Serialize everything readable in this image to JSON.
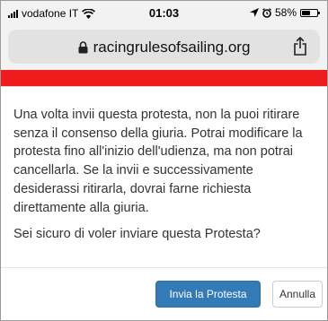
{
  "status_bar": {
    "carrier": "vodafone IT",
    "time": "01:03",
    "battery": "58%",
    "battery_level": 0.58,
    "icons": [
      "signal-icon",
      "wifi-icon",
      "location-icon",
      "alarm-icon",
      "battery-icon"
    ]
  },
  "browser": {
    "url": "racingrulesofsailing.org",
    "icons": [
      "lock-icon",
      "share-icon"
    ]
  },
  "colors": {
    "banner_red": "#ee1c1c",
    "primary_button": "#337ab7",
    "chrome_bg": "#f2f2f2",
    "url_bar_bg": "#e2e2e2"
  },
  "dialog": {
    "message": "Una volta invii questa protesta, non la puoi ritirare senza il consenso della giuria. Potrai modificare la protesta fino all'inizio dell'udienza, ma non potrai cancellarla. Se la invii e successivamente desiderassi ritirarla, dovrai farne richiesta direttamente alla giuria.",
    "question": "Sei sicuro di voler inviare questa Protesta?",
    "confirm_label": "Invia la Protesta",
    "cancel_label": "Annulla"
  }
}
